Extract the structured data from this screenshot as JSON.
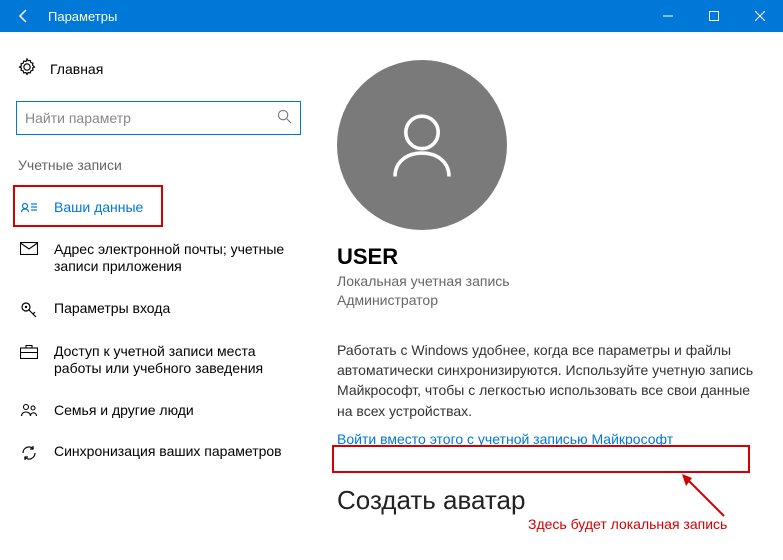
{
  "window": {
    "title": "Параметры"
  },
  "sidebar": {
    "home": "Главная",
    "search_placeholder": "Найти параметр",
    "category": "Учетные записи",
    "items": [
      {
        "label": "Ваши данные"
      },
      {
        "label": "Адрес электронной почты; учетные записи приложения"
      },
      {
        "label": "Параметры входа"
      },
      {
        "label": "Доступ к учетной записи места работы или учебного заведения"
      },
      {
        "label": "Семья и другие люди"
      },
      {
        "label": "Синхронизация ваших параметров"
      }
    ]
  },
  "main": {
    "username": "USER",
    "account_type": "Локальная учетная запись",
    "role": "Администратор",
    "description": "Работать с Windows удобнее, когда все параметры и файлы автоматически синхронизируются. Используйте учетную запись Майкрософт, чтобы с легкостью использовать все свои данные на всех устройствах.",
    "sign_in_link": "Войти вместо этого с учетной записью Майкрософт",
    "create_avatar": "Создать аватар"
  },
  "annotation": {
    "text": "Здесь будет локальная запись"
  }
}
